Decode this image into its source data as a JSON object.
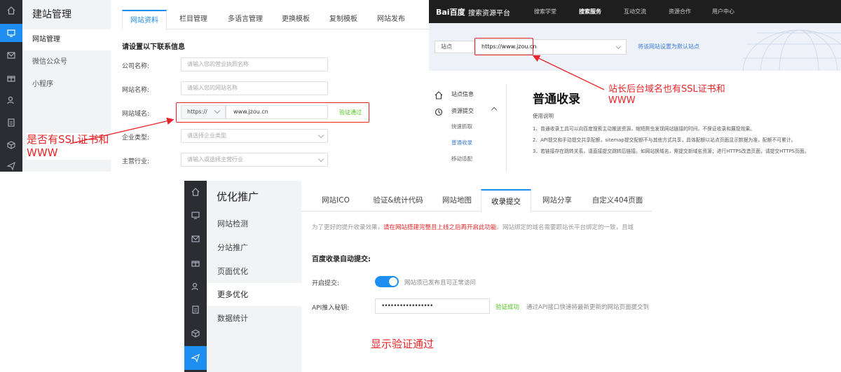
{
  "panel_a": {
    "side_title": "建站管理",
    "side_items": [
      "网站管理",
      "微信公众号",
      "小程序"
    ],
    "tabs": [
      "网站资料",
      "栏目管理",
      "多语言管理",
      "更换模板",
      "复制模板",
      "网站发布"
    ],
    "section_title": "请设置以下联系信息",
    "fields": {
      "company": {
        "label": "公司名称:",
        "placeholder": "请输入您的营业执照名称"
      },
      "site_name": {
        "label": "网站名称:",
        "placeholder": "请输入您的网站名称"
      },
      "domain": {
        "label": "网站域名:",
        "protocol": "https://",
        "value": "www.jzou.cn",
        "status": "验证通过"
      },
      "company_type": {
        "label": "企业类型:",
        "placeholder": "请选择企业类型"
      },
      "industry": {
        "label": "主营行业:",
        "placeholder": "请输入或选择主营行业"
      }
    },
    "annotation": "是否有SSL证书和WWW"
  },
  "panel_b": {
    "brand": "Bai百度",
    "brand_sub": "搜索资源平台",
    "nav": [
      "搜索学堂",
      "搜索服务",
      "互动交流",
      "资源合作",
      "用户中心"
    ],
    "site_label": "站点",
    "site_value": "https://www.jzou.cn",
    "set_default": "将该网站设置为默认站点",
    "left_nav": {
      "site_info": "站点信息",
      "submit": "资源提交",
      "sub_items": [
        "快速抓取",
        "普通收录",
        "移动适配"
      ]
    },
    "heading": "普通收录",
    "usage": "使用说明",
    "paragraphs": [
      "1、普通收录工具可以向百度搜索主动推送资源，缩短爬虫发现网站链接的时间，不保证收录和展现效果。",
      "2、API提交和手动提交共享配额，sitemap提交配额不与其他方式共享，具体配额以站点页面显示数据为准，配额不可累计。",
      "3、若链接存在跳转关系，请直接提交跳转后链接。如网站换域名，需提交新域名资源；进行HTTPS改造页面，请提交HTTPS页面。"
    ],
    "annotation": "站长后台域名也有SSL证书和WWW"
  },
  "panel_c": {
    "side_title": "优化推广",
    "side_items": [
      "网站检测",
      "分站推广",
      "页面优化",
      "更多优化",
      "数据统计"
    ],
    "tabs": [
      "网站ICO",
      "验证&统计代码",
      "网站地图",
      "收录提交",
      "网站分享",
      "自定义404页面"
    ],
    "tip_prefix": "为了更好的提升收录效果，",
    "tip_red": "请在网站搭建完整且上线之后再开启此功能",
    "tip_suffix": "。网站绑定的域名需要跟站长平台绑定的一致，且域",
    "section_title": "百度收录自动提交:",
    "enable_label": "开启提交:",
    "enable_hint": "网站须已发布且可正常访问",
    "api_label": "API推入秘钥:",
    "api_value": "•••••••••••••••••",
    "api_status": "验证成功",
    "api_hint": "通过API接口快速将最新更新的网站页面提交到",
    "annotation": "显示验证通过"
  },
  "colors": {
    "accent": "#1f8ef1",
    "annotation_red": "#e8262a",
    "success_green": "#52c41a",
    "rail_dark": "#2b2d33"
  }
}
